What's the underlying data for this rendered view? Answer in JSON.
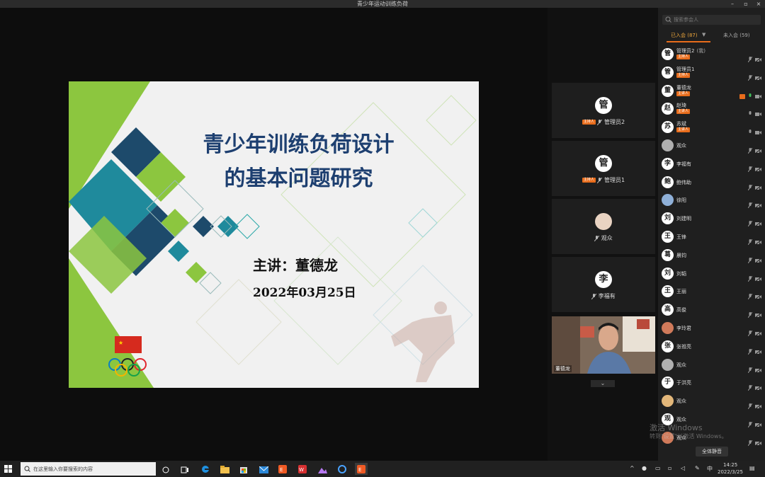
{
  "window": {
    "title": "青少年运动训练负荷"
  },
  "slide": {
    "title_line1": "青少年训练负荷设计",
    "title_line2": "的基本问题研究",
    "speaker": "主讲：董德龙",
    "date": "2022年03月25日"
  },
  "video_strip": {
    "tiles": [
      {
        "avatar": "管",
        "badge": "主持人",
        "name": "管理员2"
      },
      {
        "avatar": "管",
        "badge": "主持人",
        "name": "管理员1"
      },
      {
        "avatar": "",
        "badge": "",
        "name": "观众"
      },
      {
        "avatar": "李",
        "badge": "",
        "name": "李福有"
      }
    ],
    "camera_name": "董德龙"
  },
  "panel": {
    "search_placeholder": "搜索参会人",
    "tab_joined": "已入会 (87)",
    "tab_not_joined": "未入会 (59)",
    "mute_all": "全体静音",
    "participants": [
      {
        "avatar": "管",
        "name": "管理员2",
        "suffix": "(我)",
        "badge": "主持人"
      },
      {
        "avatar": "管",
        "name": "管理员1",
        "suffix": "",
        "badge": "主持人"
      },
      {
        "avatar": "董",
        "name": "董德龙",
        "suffix": "",
        "badge": "主讲人"
      },
      {
        "avatar": "赵",
        "name": "赵琦",
        "suffix": "",
        "badge": "主讲人"
      },
      {
        "avatar": "苏",
        "name": "苏斌",
        "suffix": "",
        "badge": "主讲人"
      },
      {
        "avatar": "",
        "name": "观众",
        "suffix": "",
        "badge": ""
      },
      {
        "avatar": "李",
        "name": "李福有",
        "suffix": "",
        "badge": ""
      },
      {
        "avatar": "鲍",
        "name": "鲍伟助",
        "suffix": "",
        "badge": ""
      },
      {
        "avatar": "",
        "name": "徐阳",
        "suffix": "",
        "badge": ""
      },
      {
        "avatar": "刘",
        "name": "刘建明",
        "suffix": "",
        "badge": ""
      },
      {
        "avatar": "王",
        "name": "王锋",
        "suffix": "",
        "badge": ""
      },
      {
        "avatar": "葛",
        "name": "晨钧",
        "suffix": "",
        "badge": ""
      },
      {
        "avatar": "刘",
        "name": "刘韬",
        "suffix": "",
        "badge": ""
      },
      {
        "avatar": "王",
        "name": "王丽",
        "suffix": "",
        "badge": ""
      },
      {
        "avatar": "高",
        "name": "高俊",
        "suffix": "",
        "badge": ""
      },
      {
        "avatar": "",
        "name": "李玲君",
        "suffix": "",
        "badge": ""
      },
      {
        "avatar": "张",
        "name": "张祖亮",
        "suffix": "",
        "badge": ""
      },
      {
        "avatar": "",
        "name": "观众",
        "suffix": "",
        "badge": ""
      },
      {
        "avatar": "于",
        "name": "于洪亮",
        "suffix": "",
        "badge": ""
      },
      {
        "avatar": "",
        "name": "观众",
        "suffix": "",
        "badge": ""
      },
      {
        "avatar": "观",
        "name": "观众",
        "suffix": "",
        "badge": ""
      },
      {
        "avatar": "",
        "name": "观众",
        "suffix": "",
        "badge": ""
      }
    ]
  },
  "watermark": {
    "line1": "激活 Windows",
    "line2": "转到\"设置\"以激活 Windows。"
  },
  "taskbar": {
    "search_placeholder": "在这里输入你要搜索的内容",
    "ime": "中",
    "time": "14:25",
    "date": "2022/3/25"
  },
  "colors": {
    "accent": "#e86c1b",
    "slide_title": "#1d3f70",
    "green": "#8cc63f",
    "teal": "#1f8a9c",
    "navy": "#1d4a6b"
  }
}
